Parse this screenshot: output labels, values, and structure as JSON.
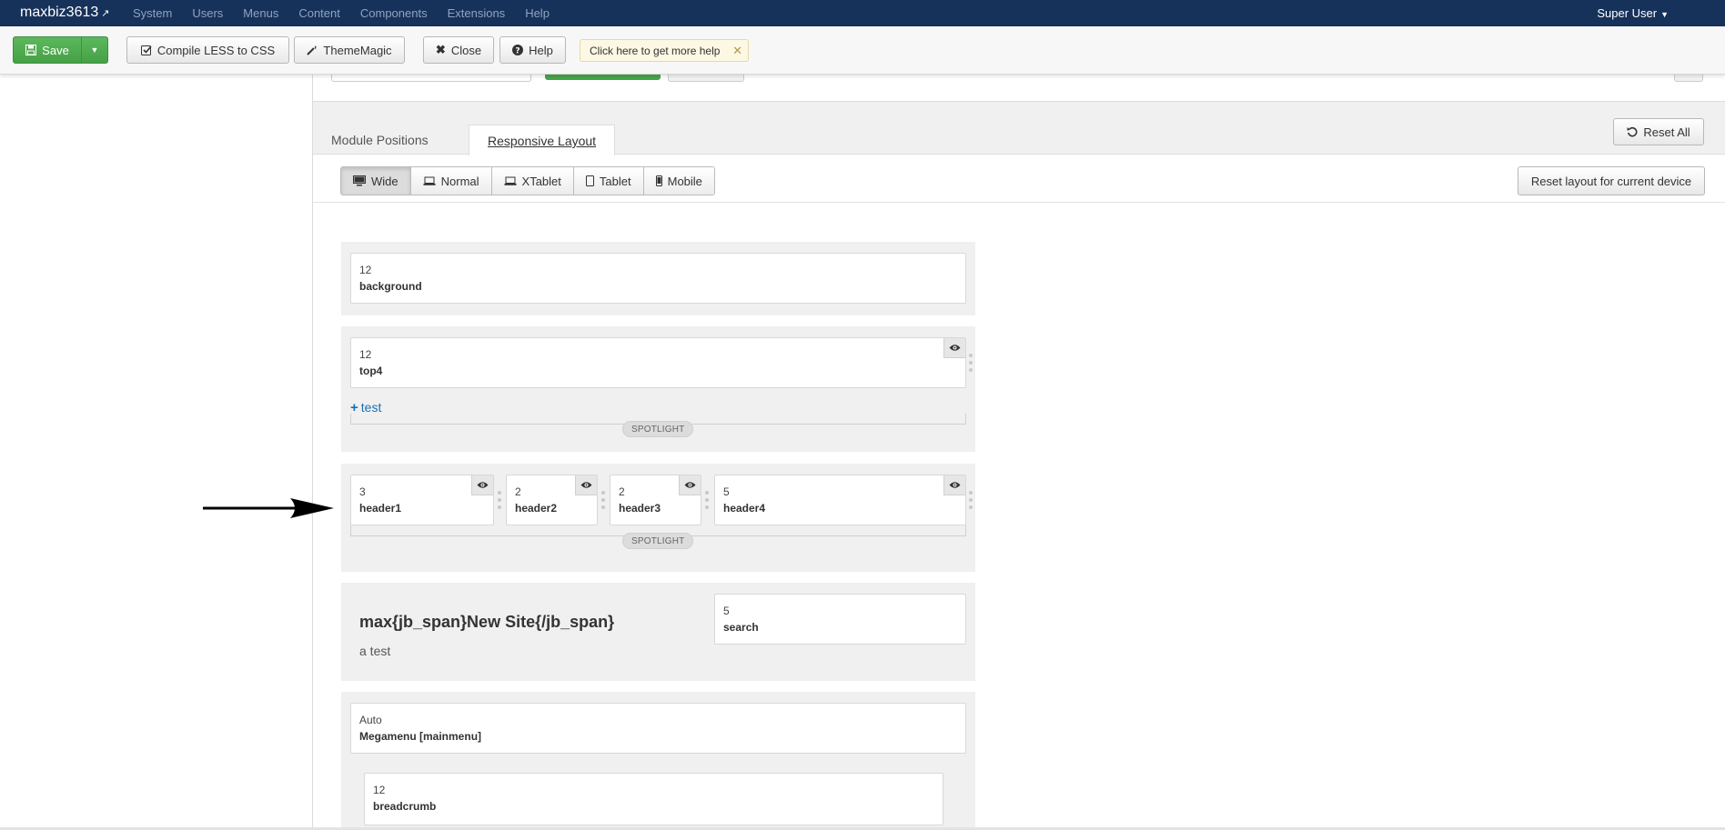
{
  "navbar": {
    "brand": "maxbiz3613",
    "menu": [
      "System",
      "Users",
      "Menus",
      "Content",
      "Components",
      "Extensions",
      "Help"
    ],
    "user": "Super User"
  },
  "toolbar": {
    "save": "Save",
    "compile": "Compile LESS to CSS",
    "thememagic": "ThemeMagic",
    "close": "Close",
    "help": "Help",
    "tip": "Click here to get more help"
  },
  "tabs": {
    "module_positions": "Module Positions",
    "responsive_layout": "Responsive Layout",
    "reset_all": "Reset All"
  },
  "devices": {
    "items": [
      "Wide",
      "Normal",
      "XTablet",
      "Tablet",
      "Mobile"
    ],
    "active": "Wide",
    "reset_label": "Reset layout for current device"
  },
  "layout": {
    "background": {
      "width": "12",
      "name": "background"
    },
    "top4": {
      "width": "12",
      "name": "top4"
    },
    "add_link": "test",
    "spotlight_label": "SPOTLIGHT",
    "headers": [
      {
        "width": "3",
        "name": "header1"
      },
      {
        "width": "2",
        "name": "header2"
      },
      {
        "width": "2",
        "name": "header3"
      },
      {
        "width": "5",
        "name": "header4"
      }
    ],
    "site_name": "max{jb_span}New Site{/jb_span}",
    "slogan": "a test",
    "search": {
      "width": "5",
      "name": "search"
    },
    "megamenu": {
      "width": "Auto",
      "name": "Megamenu [mainmenu]"
    },
    "breadcrumb": {
      "width": "12",
      "name": "breadcrumb"
    }
  },
  "icons": {
    "eye": "eye-icon",
    "arrow": "annotation-arrow"
  }
}
